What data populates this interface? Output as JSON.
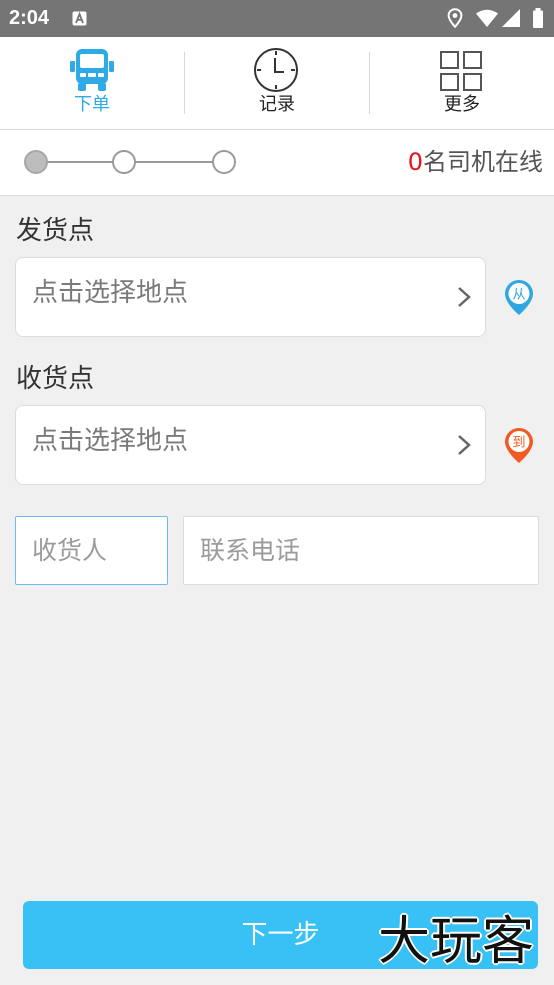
{
  "status_bar": {
    "time": "2:04",
    "icons": [
      "app-notification-icon",
      "location-icon",
      "wifi-icon",
      "signal-icon",
      "battery-icon"
    ]
  },
  "tabs": [
    {
      "label": "下单",
      "icon": "truck-icon",
      "active": true
    },
    {
      "label": "记录",
      "icon": "clock-icon",
      "active": false
    },
    {
      "label": "更多",
      "icon": "grid-icon",
      "active": false
    }
  ],
  "progress": {
    "steps": 3,
    "current_step": 1
  },
  "online_drivers": {
    "count": "0",
    "text": "名司机在线"
  },
  "pickup": {
    "label": "发货点",
    "placeholder": "点击选择地点",
    "pin_text": "从"
  },
  "delivery": {
    "label": "收货点",
    "placeholder": "点击选择地点",
    "pin_text": "到"
  },
  "contact": {
    "name_placeholder": "收货人",
    "phone_placeholder": "联系电话"
  },
  "next_button": {
    "label": "下一步"
  },
  "watermark": {
    "text": "大玩客"
  },
  "colors": {
    "status_bar": "#757575",
    "accent": "#2eaae6",
    "button": "#38c1f4",
    "online_count": "#e8141b",
    "pickup_pin": "#2ea7e0",
    "delivery_pin": "#f15a22",
    "background": "#f0f0f0"
  }
}
